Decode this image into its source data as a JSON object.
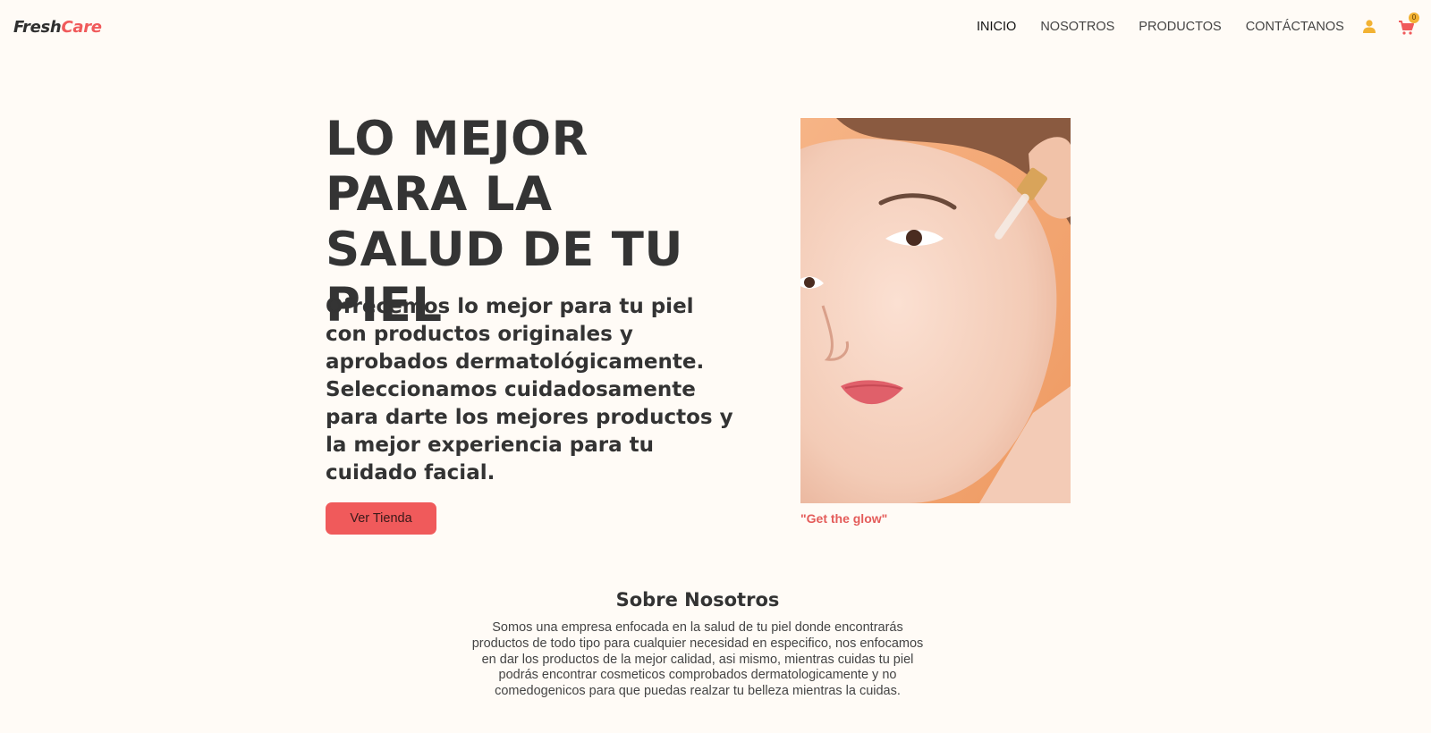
{
  "brand": {
    "part1": "Fresh",
    "part2": "Care"
  },
  "nav": {
    "items": [
      {
        "label": "INICIO",
        "active": true
      },
      {
        "label": "NOSOTROS",
        "active": false
      },
      {
        "label": "PRODUCTOS",
        "active": false
      },
      {
        "label": "CONTÁCTANOS",
        "active": false
      }
    ],
    "user_icon": "user-icon",
    "cart_icon": "cart-icon",
    "cart_count": "0"
  },
  "hero": {
    "title": "LO MEJOR PARA LA SALUD DE TU PIEL",
    "text": "Ofrecemos lo mejor para tu piel con productos originales y aprobados dermatológicamente. Seleccionamos cuidadosamente para darte los mejores productos y la mejor experiencia para tu cuidado facial.",
    "button": "Ver Tienda",
    "caption": "\"Get the glow\""
  },
  "about": {
    "title": "Sobre Nosotros",
    "text": "Somos una empresa enfocada en la salud de tu piel donde encontrarás productos de todo tipo para cualquier necesidad en especifico, nos enfocamos en dar los productos de la mejor calidad, asi mismo, mientras cuidas tu piel podrás encontrar cosmeticos comprobados dermatologicamente y no comedogenicos para que puedas realzar tu belleza mientras la cuidas."
  },
  "colors": {
    "accent": "#f05a5b",
    "badge": "#f2b233",
    "background": "#fffbf6",
    "photo_bg": "#f2a06c"
  }
}
